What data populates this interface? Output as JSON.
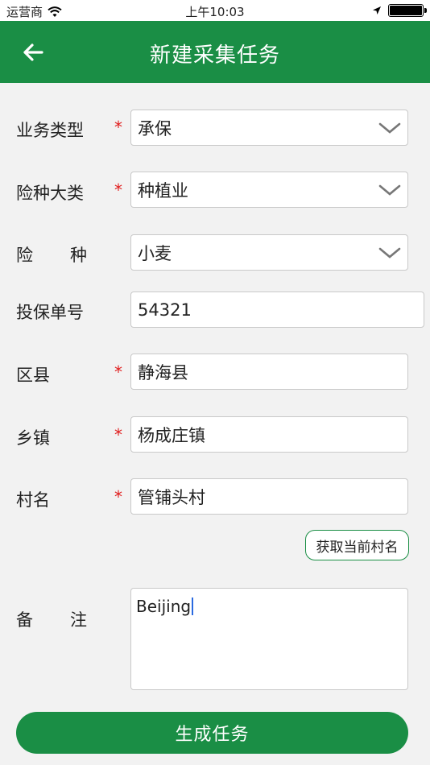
{
  "status_bar": {
    "carrier": "运营商",
    "time": "上午10:03"
  },
  "header": {
    "title": "新建采集任务"
  },
  "form": {
    "business_type": {
      "label": "业务类型",
      "required": "*",
      "value": "承保"
    },
    "insurance_category": {
      "label": "险种大类",
      "required": "*",
      "value": "种植业"
    },
    "insurance_type": {
      "label_left": "险",
      "label_right": "种",
      "value": "小麦"
    },
    "policy_number": {
      "label": "投保单号",
      "value": "54321"
    },
    "district": {
      "label": "区县",
      "required": "*",
      "value": "静海县"
    },
    "town": {
      "label": "乡镇",
      "required": "*",
      "value": "杨成庄镇"
    },
    "village": {
      "label": "村名",
      "required": "*",
      "value": "管铺头村"
    },
    "get_village_button": "获取当前村名",
    "remarks": {
      "label_left": "备",
      "label_right": "注",
      "value": "Beijing"
    }
  },
  "submit_button": "生成任务",
  "colors": {
    "primary": "#1a8e45",
    "required": "#e01b1b",
    "background": "#f2f2f2"
  },
  "icons": [
    "wifi-icon",
    "location-arrow-icon",
    "battery-icon",
    "back-arrow-icon",
    "chevron-down-icon"
  ]
}
